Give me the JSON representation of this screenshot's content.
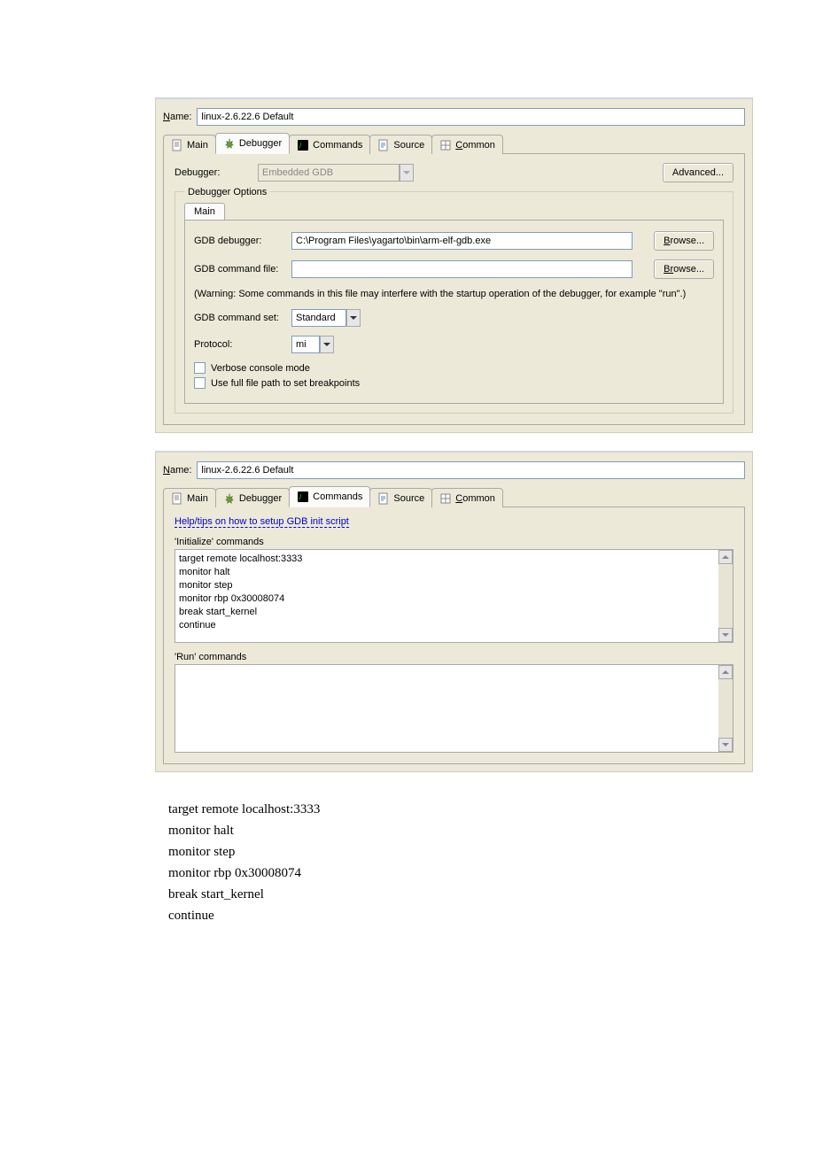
{
  "panel1": {
    "name_label_pre": "N",
    "name_label": "ame:",
    "name_value": "linux-2.6.22.6 Default",
    "tabs": {
      "main": "Main",
      "debugger": "Debugger",
      "commands": "Commands",
      "source": "Source",
      "common_pre": "C",
      "common": "ommon"
    },
    "debugger_label": "Debugger:",
    "debugger_value": "Embedded GDB",
    "advanced_btn": "Advanced...",
    "fieldset_title": "Debugger Options",
    "inner_tab": "Main",
    "gdb_debugger_label": "GDB debugger:",
    "gdb_debugger_value": "C:\\Program Files\\yagarto\\bin\\arm-elf-gdb.exe",
    "browse_btn_pre": "B",
    "browse_btn": "rowse...",
    "gdb_cmdfile_label": "GDB command file:",
    "gdb_cmdfile_value": "",
    "browse2_pre": "Br",
    "browse2": "owse...",
    "warning": "(Warning: Some commands in this file may interfere with the startup operation of the debugger, for example \"run\".)",
    "cmdset_label": "GDB command set:",
    "cmdset_value": "Standard",
    "protocol_label": "Protocol:",
    "protocol_value": "mi",
    "verbose_label": "Verbose console mode",
    "fullpath_label": "Use full file path to set breakpoints"
  },
  "panel2": {
    "name_label_pre": "N",
    "name_label": "ame:",
    "name_value": "linux-2.6.22.6 Default",
    "tabs": {
      "main": "Main",
      "debugger": "Debugger",
      "commands": "Commands",
      "source": "Source",
      "common_pre": "C",
      "common": "ommon"
    },
    "help_link": "Help/tips on how to setup GDB init script",
    "init_section": "'Initialize' commands",
    "init_text": "target remote localhost:3333\nmonitor halt\nmonitor step\nmonitor rbp 0x30008074\nbreak start_kernel\ncontinue",
    "run_section": "'Run' commands",
    "run_text": ""
  },
  "plain_block": "target remote localhost:3333\nmonitor halt\nmonitor step\nmonitor rbp 0x30008074\nbreak start_kernel\ncontinue"
}
